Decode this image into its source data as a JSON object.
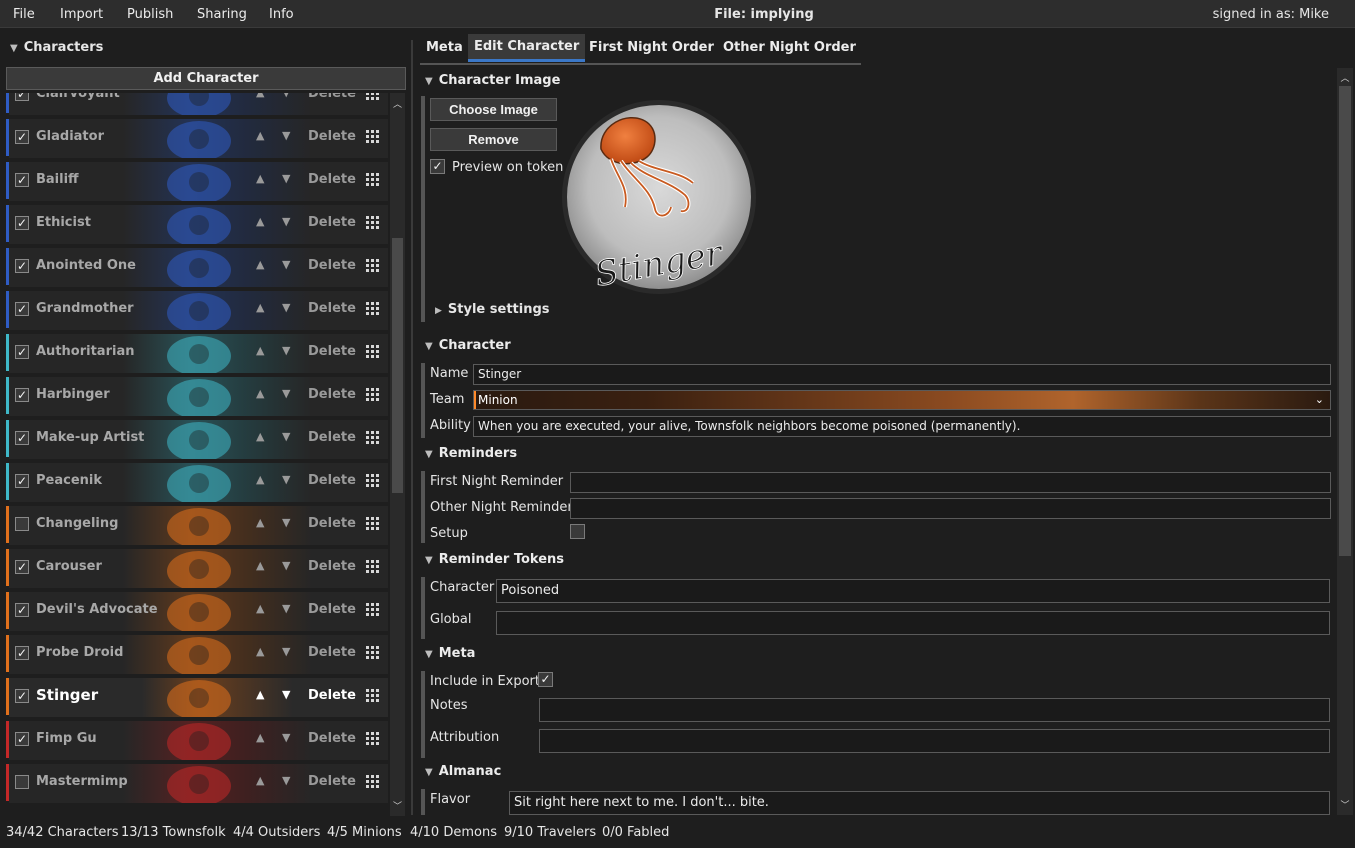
{
  "menu": {
    "file": "File",
    "import": "Import",
    "publish": "Publish",
    "sharing": "Sharing",
    "info": "Info"
  },
  "window": {
    "file_title": "File: implying",
    "signed_in": "signed in as: Mike"
  },
  "left": {
    "header": "Characters",
    "add_button": "Add Character",
    "delete_label": "Delete",
    "characters": [
      {
        "name": "Clairvoyant",
        "checked": true,
        "team": "townsfolk"
      },
      {
        "name": "Gladiator",
        "checked": true,
        "team": "townsfolk"
      },
      {
        "name": "Bailiff",
        "checked": true,
        "team": "townsfolk"
      },
      {
        "name": "Ethicist",
        "checked": true,
        "team": "townsfolk"
      },
      {
        "name": "Anointed One",
        "checked": true,
        "team": "townsfolk"
      },
      {
        "name": "Grandmother",
        "checked": true,
        "team": "townsfolk"
      },
      {
        "name": "Authoritarian",
        "checked": true,
        "team": "outsider"
      },
      {
        "name": "Harbinger",
        "checked": true,
        "team": "outsider"
      },
      {
        "name": "Make-up Artist",
        "checked": true,
        "team": "outsider"
      },
      {
        "name": "Peacenik",
        "checked": true,
        "team": "outsider"
      },
      {
        "name": "Changeling",
        "checked": false,
        "team": "minion"
      },
      {
        "name": "Carouser",
        "checked": true,
        "team": "minion"
      },
      {
        "name": "Devil's Advocate",
        "checked": true,
        "team": "minion"
      },
      {
        "name": "Probe Droid",
        "checked": true,
        "team": "minion"
      },
      {
        "name": "Stinger",
        "checked": true,
        "team": "minion",
        "selected": true
      },
      {
        "name": "Fimp Gu",
        "checked": true,
        "team": "demon"
      },
      {
        "name": "Mastermimp",
        "checked": false,
        "team": "demon"
      }
    ]
  },
  "tabs": {
    "meta": "Meta",
    "edit": "Edit Character",
    "first_night": "First Night Order",
    "other_night": "Other Night Order"
  },
  "image_section": {
    "header": "Character Image",
    "choose_button": "Choose Image",
    "remove_button": "Remove",
    "preview_label": "Preview on token",
    "preview_checked": true,
    "token_text": "Stinger",
    "style_settings": "Style settings"
  },
  "character_section": {
    "header": "Character",
    "name_label": "Name",
    "name_value": "Stinger",
    "team_label": "Team",
    "team_value": "Minion",
    "ability_label": "Ability",
    "ability_value": "When you are executed, your alive, Townsfolk neighbors become poisoned (permanently)."
  },
  "reminders_section": {
    "header": "Reminders",
    "first_night_label": "First Night Reminder",
    "first_night_value": "",
    "other_night_label": "Other Night Reminder",
    "other_night_value": "",
    "setup_label": "Setup",
    "setup_checked": false
  },
  "reminder_tokens_section": {
    "header": "Reminder Tokens",
    "character_label": "Character",
    "character_value": "Poisoned",
    "global_label": "Global",
    "global_value": ""
  },
  "meta_section": {
    "header": "Meta",
    "include_label": "Include in Export",
    "include_checked": true,
    "notes_label": "Notes",
    "notes_value": "",
    "attribution_label": "Attribution",
    "attribution_value": ""
  },
  "almanac_section": {
    "header": "Almanac",
    "flavor_label": "Flavor",
    "flavor_value": "Sit right here next to me. I don't... bite."
  },
  "status": {
    "characters": "34/42 Characters",
    "townsfolk": "13/13 Townsfolk",
    "outsiders": "4/4 Outsiders",
    "minions": "4/5 Minions",
    "demons": "4/10 Demons",
    "travelers": "9/10 Travelers",
    "fabled": "0/0 Fabled"
  },
  "colors": {
    "townsfolk": "#2f5cc4",
    "outsider": "#3fb8c8",
    "minion": "#e0701c",
    "demon": "#c42828",
    "accent": "#3b78c8"
  }
}
